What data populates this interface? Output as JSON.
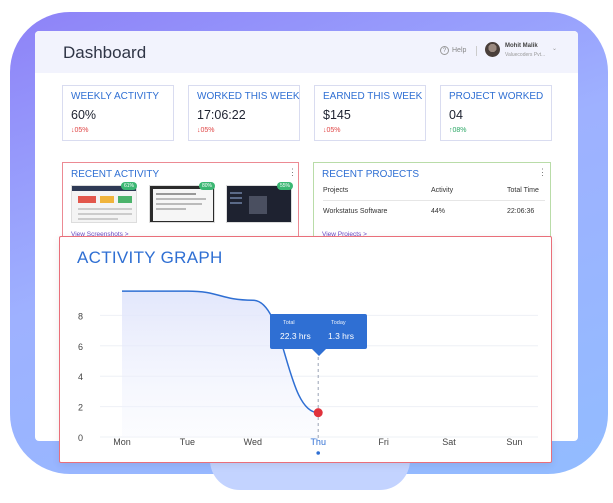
{
  "header": {
    "title": "Dashboard",
    "help_label": "Help",
    "user_name": "Mohit Malik",
    "user_org": "Valuecoders Pvt..."
  },
  "stats": [
    {
      "label": "WEEKLY ACTIVITY",
      "value": "60%",
      "change": "↓05%",
      "trend": "down"
    },
    {
      "label": "WORKED THIS WEEK",
      "value": "17:06:22",
      "change": "↓05%",
      "trend": "down"
    },
    {
      "label": "EARNED THIS WEEK",
      "value": "$145",
      "change": "↓05%",
      "trend": "down"
    },
    {
      "label": "PROJECT WORKED",
      "value": "04",
      "change": "↑08%",
      "trend": "up"
    }
  ],
  "recent_activity": {
    "title": "RECENT ACTIVITY",
    "screenshots": [
      {
        "pct": "61%"
      },
      {
        "pct": "80%"
      },
      {
        "pct": "55%"
      }
    ],
    "link": "View Screenshots >"
  },
  "recent_projects": {
    "title": "RECENT PROJECTS",
    "columns": [
      "Projects",
      "Activity",
      "Total Time"
    ],
    "rows": [
      {
        "project": "Workstatus Software",
        "activity": "44%",
        "time": "22:06:36"
      }
    ],
    "link": "View Projects >"
  },
  "activity_graph": {
    "title": "ACTIVITY GRAPH",
    "tooltip": {
      "total_label": "Total",
      "total_value": "22.3 hrs",
      "today_label": "Today",
      "today_value": "1.3 hrs"
    },
    "accent": "#2f6fd3",
    "highlight": "#e0323c"
  },
  "chart_data": {
    "type": "area",
    "categories": [
      "Mon",
      "Tue",
      "Wed",
      "Thu",
      "Fri",
      "Sat",
      "Sun"
    ],
    "ytick_labels": [
      "0",
      "2",
      "4",
      "6",
      "8"
    ],
    "ylim": [
      0,
      10
    ],
    "series": [
      {
        "values": [
          9.6,
          9.6,
          9.0,
          1.6
        ]
      }
    ],
    "highlight_category": "Thu"
  }
}
